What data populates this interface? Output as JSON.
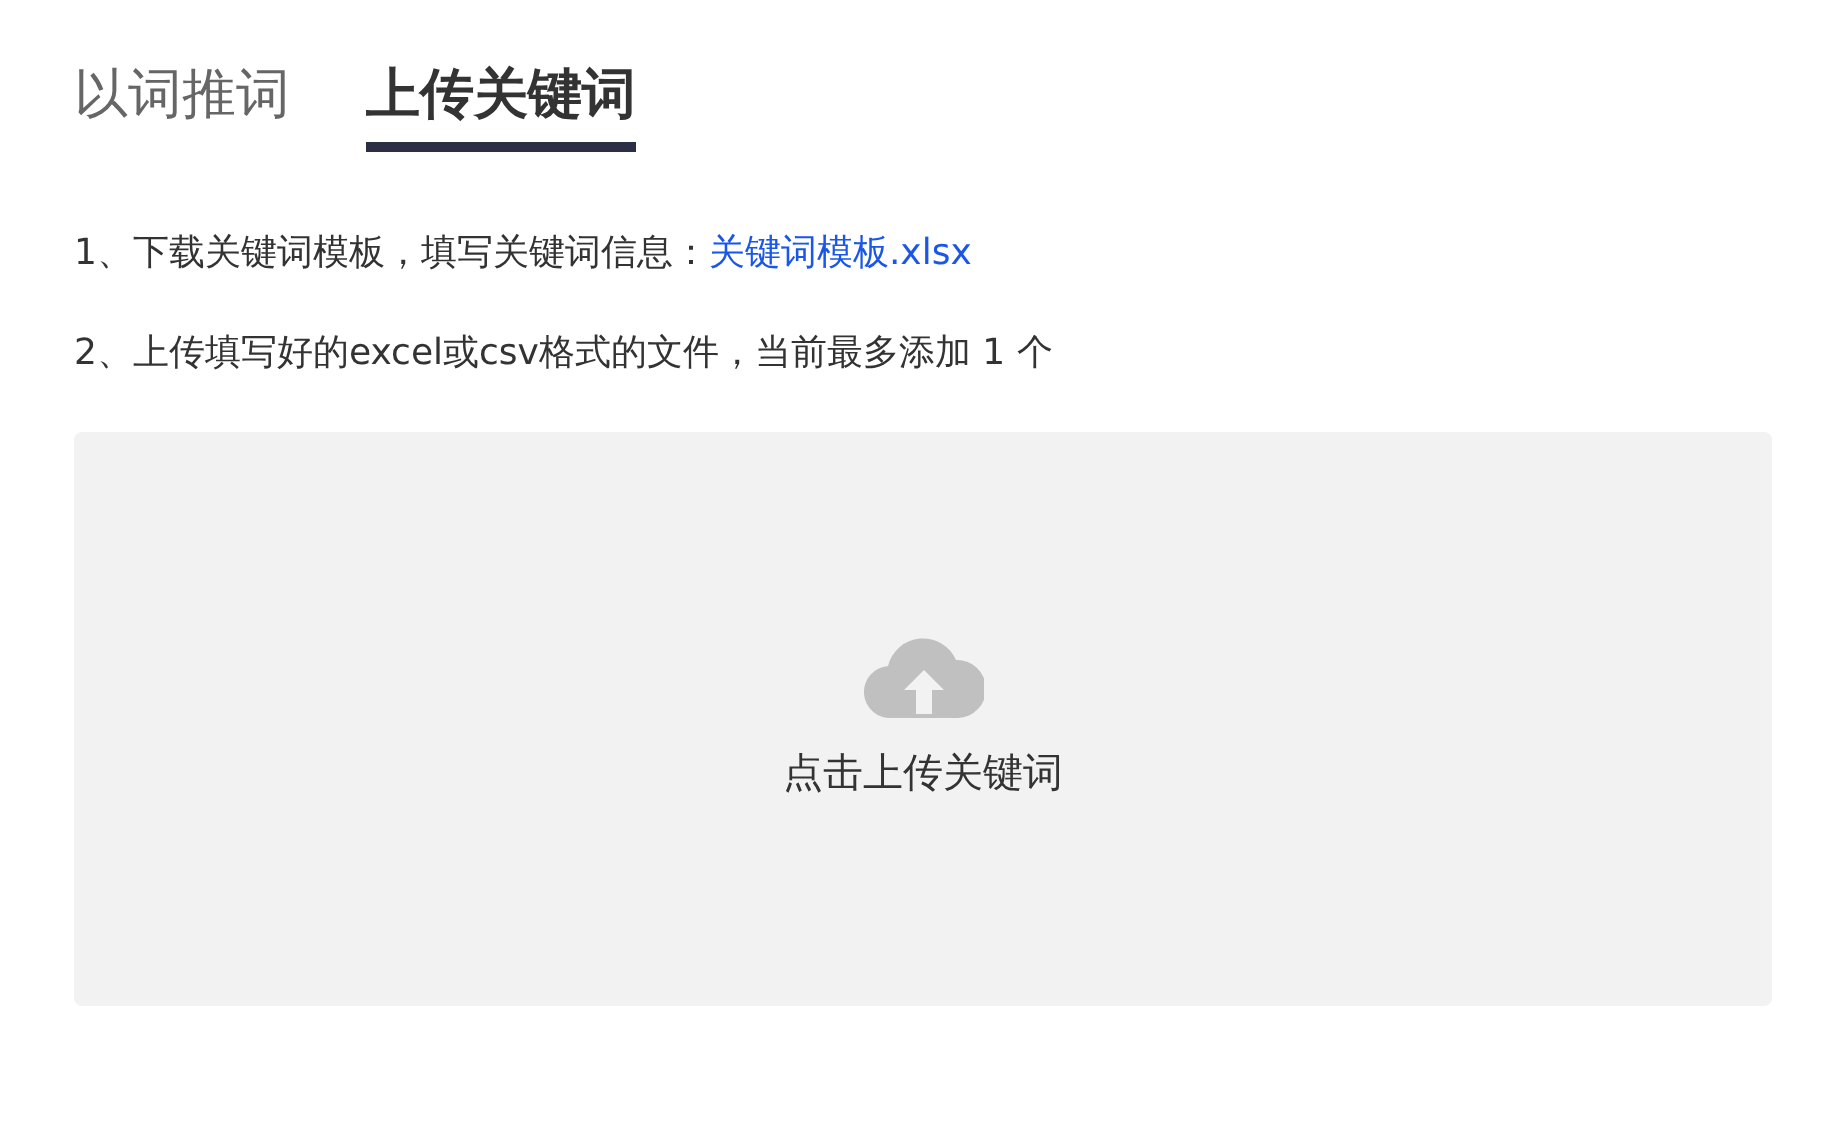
{
  "tabs": [
    {
      "label": "以词推词",
      "selected": false
    },
    {
      "label": "上传关键词",
      "selected": true
    }
  ],
  "instructions": [
    {
      "text": "1、下载关键词模板，填写关键词信息：",
      "link": "关键词模板.xlsx"
    },
    {
      "text": "2、上传填写好的excel或csv格式的文件，当前最多添加 1 个"
    }
  ],
  "upload": {
    "label": "点击上传关键词"
  }
}
